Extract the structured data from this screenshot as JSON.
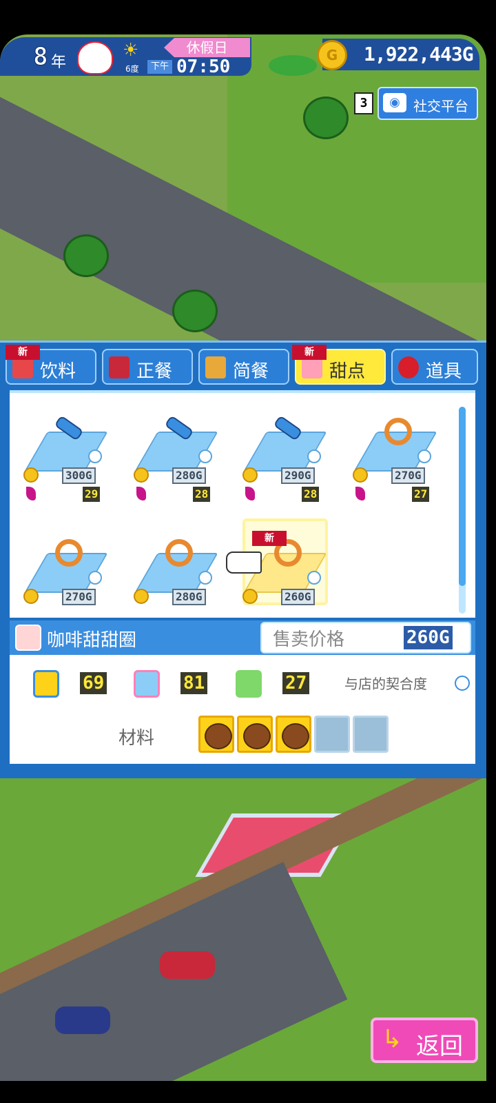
{
  "hud": {
    "year": "8",
    "year_label": "年",
    "holiday": "休假日",
    "ampm": "下午",
    "time": "07:50",
    "temperature": "6度",
    "money": "1,922,443G",
    "coin_icon": "G",
    "social_count": "3",
    "social_label": "社交平台"
  },
  "tabs": [
    {
      "label": "饮料",
      "new": "新",
      "icon": "drink-icon"
    },
    {
      "label": "正餐",
      "icon": "meal-icon"
    },
    {
      "label": "简餐",
      "icon": "snack-icon"
    },
    {
      "label": "甜点",
      "new": "新",
      "icon": "dessert-icon",
      "active": true
    },
    {
      "label": "道具",
      "icon": "apple-icon"
    }
  ],
  "items": [
    {
      "food": "ice-pop",
      "price": "300G",
      "mood": "29"
    },
    {
      "food": "ice-pop",
      "price": "280G",
      "mood": "28"
    },
    {
      "food": "ice-pop",
      "price": "290G",
      "mood": "28"
    },
    {
      "food": "donut",
      "price": "270G",
      "mood": "27"
    },
    {
      "food": "donut",
      "price": "270G"
    },
    {
      "food": "donut",
      "price": "280G"
    },
    {
      "food": "donut",
      "price": "260G",
      "new": "新",
      "selected": true
    }
  ],
  "info": {
    "name": "咖啡甜甜圈",
    "sale_label": "售卖价格",
    "sale_value": "260G"
  },
  "stats": {
    "taste": "69",
    "look": "81",
    "popularity": "27",
    "compat_label": "与店的契合度",
    "material_label": "材料",
    "materials_filled": 3,
    "materials_total": 5
  },
  "back_label": "返回"
}
